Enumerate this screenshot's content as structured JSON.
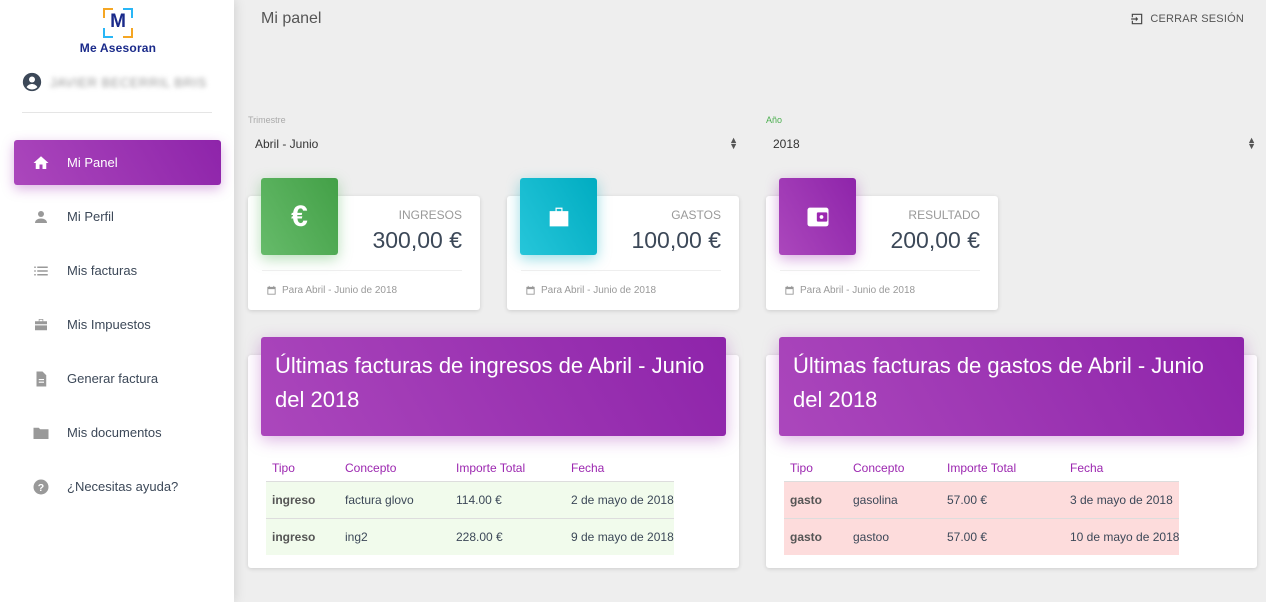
{
  "sidebar": {
    "logo_text": "Me Asesoran",
    "logo_letter": "M",
    "user_name": "JAVIER BECERRIL BRIS",
    "items": [
      {
        "label": "Mi Panel",
        "icon": "home-icon",
        "active": true
      },
      {
        "label": "Mi Perfil",
        "icon": "person-icon",
        "active": false
      },
      {
        "label": "Mis facturas",
        "icon": "list-icon",
        "active": false
      },
      {
        "label": "Mis Impuestos",
        "icon": "briefcase-icon",
        "active": false
      },
      {
        "label": "Generar factura",
        "icon": "document-icon",
        "active": false
      },
      {
        "label": "Mis documentos",
        "icon": "folder-icon",
        "active": false
      },
      {
        "label": "¿Necesitas ayuda?",
        "icon": "help-icon",
        "active": false
      }
    ]
  },
  "header": {
    "title": "Mi panel",
    "logout_label": "CERRAR SESIÓN"
  },
  "filters": {
    "trimestre_label": "Trimestre",
    "trimestre_value": "Abril - Junio",
    "anio_label": "Año",
    "anio_value": "2018"
  },
  "stats": [
    {
      "label": "INGRESOS",
      "value": "300,00 €",
      "footer": "Para Abril - Junio de 2018",
      "icon": "euro-icon",
      "color": "#4caf50"
    },
    {
      "label": "GASTOS",
      "value": "100,00 €",
      "footer": "Para Abril - Junio de 2018",
      "icon": "briefcase-icon",
      "color": "#00acc1"
    },
    {
      "label": "RESULTADO",
      "value": "200,00 €",
      "footer": "Para Abril - Junio de 2018",
      "icon": "wallet-icon",
      "color": "#9c27b0"
    }
  ],
  "ingresos_table": {
    "title": "Últimas facturas de ingresos de Abril - Junio del 2018",
    "columns": [
      "Tipo",
      "Concepto",
      "Importe Total",
      "Fecha"
    ],
    "rows": [
      [
        "ingreso",
        "factura glovo",
        "114.00 €",
        "2 de mayo de 2018"
      ],
      [
        "ingreso",
        "ing2",
        "228.00 €",
        "9 de mayo de 2018"
      ]
    ]
  },
  "gastos_table": {
    "title": "Últimas facturas de gastos de Abril - Junio del 2018",
    "columns": [
      "Tipo",
      "Concepto",
      "Importe Total",
      "Fecha"
    ],
    "rows": [
      [
        "gasto",
        "gasolina",
        "57.00 €",
        "3 de mayo de 2018"
      ],
      [
        "gasto",
        "gastoo",
        "57.00 €",
        "10 de mayo de 2018"
      ]
    ]
  },
  "colors": {
    "accent": "#9c27b0",
    "income_row": "#f1fbec",
    "expense_row": "#fddcdc"
  }
}
